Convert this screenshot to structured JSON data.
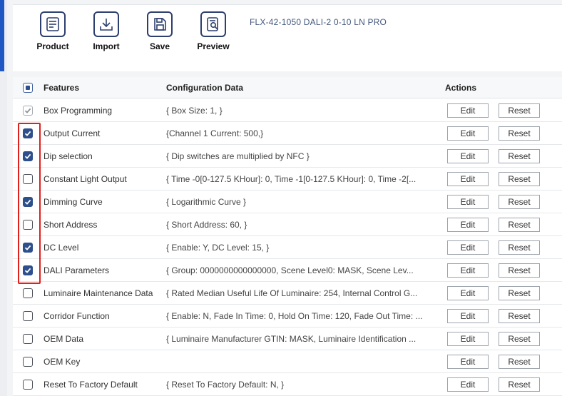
{
  "toolbar": {
    "buttons": [
      {
        "label": "Product",
        "icon": "document-icon"
      },
      {
        "label": "Import",
        "icon": "download-icon"
      },
      {
        "label": "Save",
        "icon": "floppy-disk-icon"
      },
      {
        "label": "Preview",
        "icon": "preview-document-icon"
      }
    ],
    "device_title": "FLX-42-1050 DALI-2 0-10 LN PRO"
  },
  "table": {
    "headers": {
      "features": "Features",
      "configuration": "Configuration Data",
      "actions": "Actions"
    },
    "edit_label": "Edit",
    "reset_label": "Reset",
    "rows": [
      {
        "feature": "Box Programming",
        "config": "{ Box Size: 1, }",
        "checked": true,
        "disabled": true
      },
      {
        "feature": "Output Current",
        "config": "{Channel 1 Current: 500,}",
        "checked": true
      },
      {
        "feature": "Dip selection",
        "config": "{ Dip switches are multiplied by NFC }",
        "checked": true
      },
      {
        "feature": "Constant Light Output",
        "config": "{ Time -0[0-127.5 KHour]: 0, Time -1[0-127.5 KHour]: 0, Time -2[...",
        "checked": false
      },
      {
        "feature": "Dimming Curve",
        "config": "{ Logarithmic Curve }",
        "checked": true
      },
      {
        "feature": "Short Address",
        "config": "{ Short Address: 60, }",
        "checked": false
      },
      {
        "feature": "DC Level",
        "config": "{ Enable: Y, DC Level: 15, }",
        "checked": true
      },
      {
        "feature": "DALI Parameters",
        "config": "{ Group: 0000000000000000, Scene Level0: MASK, Scene Lev...",
        "checked": true
      },
      {
        "feature": "Luminaire Maintenance Data",
        "config": "{ Rated Median Useful Life Of Luminaire: 254, Internal Control G...",
        "checked": false
      },
      {
        "feature": "Corridor Function",
        "config": "{ Enable: N, Fade In Time: 0, Hold On Time: 120, Fade Out Time: ...",
        "checked": false
      },
      {
        "feature": "OEM Data",
        "config": "{ Luminaire Manufacturer GTIN: MASK, Luminaire Identification ...",
        "checked": false
      },
      {
        "feature": "OEM Key",
        "config": "",
        "checked": false
      },
      {
        "feature": "Reset To Factory Default",
        "config": "{ Reset To Factory Default: N, }",
        "checked": false
      }
    ]
  },
  "colors": {
    "accent": "#1f57c3",
    "checkbox_checked": "#2d4f8c",
    "highlight": "#e0201b"
  }
}
